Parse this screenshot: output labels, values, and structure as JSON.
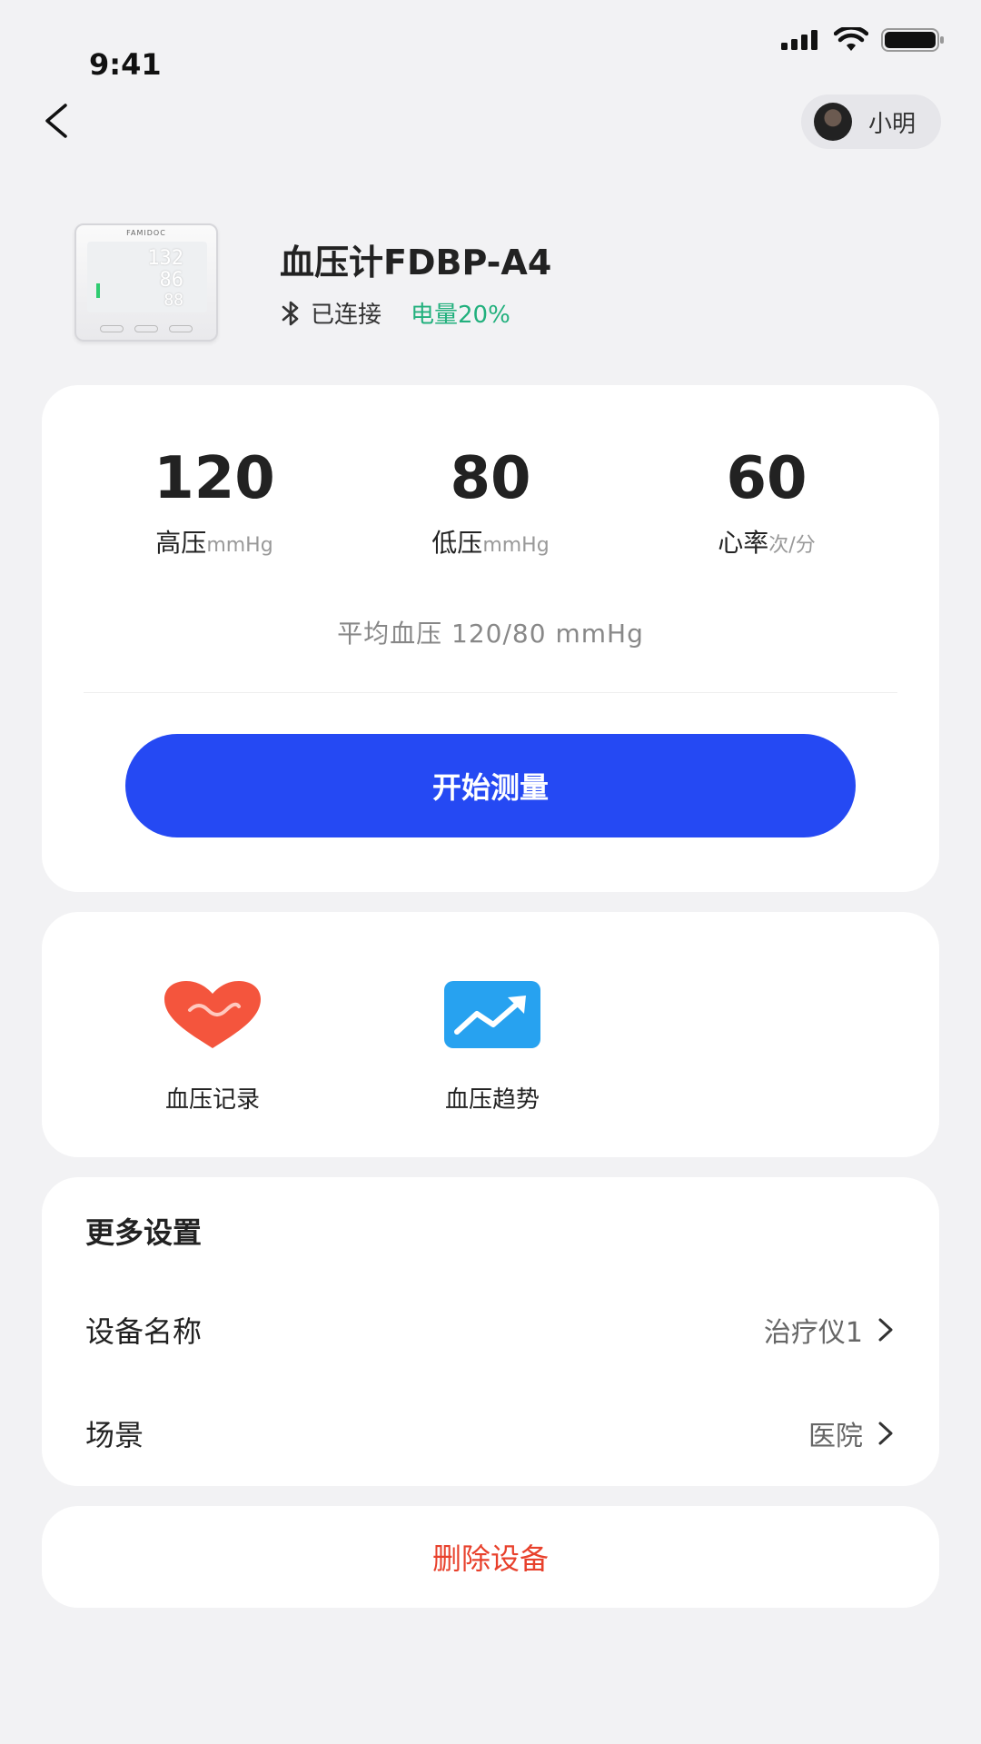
{
  "status_bar": {
    "time": "9:41"
  },
  "nav": {
    "user_name": "小明"
  },
  "device": {
    "name": "血压计FDBP-A4",
    "connection": "已连接",
    "battery": "电量20%",
    "image": {
      "brand": "FAMIDOC",
      "reading_1": "132",
      "reading_2": "86",
      "reading_3": "88"
    }
  },
  "measurement": {
    "metrics": [
      {
        "value": "120",
        "label": "高压",
        "unit": "mmHg"
      },
      {
        "value": "80",
        "label": "低压",
        "unit": "mmHg"
      },
      {
        "value": "60",
        "label": "心率",
        "unit": "次/分"
      }
    ],
    "average": "平均血压 120/80 mmHg",
    "start_button": "开始测量"
  },
  "tools": [
    {
      "label": "血压记录",
      "icon": "heart-icon",
      "color": "#f4553d"
    },
    {
      "label": "血压趋势",
      "icon": "trend-chart-icon",
      "color": "#27a2f0"
    }
  ],
  "settings": {
    "title": "更多设置",
    "rows": [
      {
        "label": "设备名称",
        "value": "治疗仪1"
      },
      {
        "label": "场景",
        "value": "医院"
      }
    ]
  },
  "delete_button": "删除设备",
  "colors": {
    "primary": "#2549f3",
    "success": "#22b07d",
    "danger": "#e8412c",
    "background": "#f2f2f4"
  }
}
